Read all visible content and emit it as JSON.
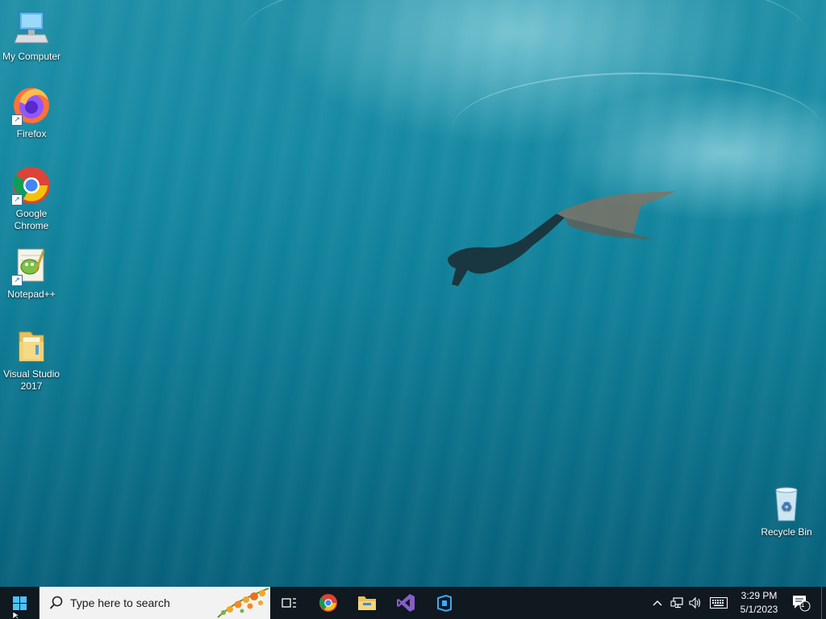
{
  "desktop": {
    "icons": [
      {
        "label": "My Computer"
      },
      {
        "label": "Firefox"
      },
      {
        "label": "Google Chrome"
      },
      {
        "label": "Notepad++"
      },
      {
        "label": "Visual Studio 2017"
      },
      {
        "label": "Recycle Bin"
      }
    ]
  },
  "taskbar": {
    "search_placeholder": "Type here to search",
    "pinned": [
      "chrome-icon",
      "file-explorer-icon",
      "visual-studio-icon",
      "azure-data-studio-icon"
    ],
    "clock": {
      "time": "3:29 PM",
      "date": "5/1/2023"
    },
    "notifications": {
      "count": "1"
    }
  },
  "colors": {
    "taskbar": "#101820",
    "search_box": "#f2f2f2",
    "water": "#168aa3"
  }
}
